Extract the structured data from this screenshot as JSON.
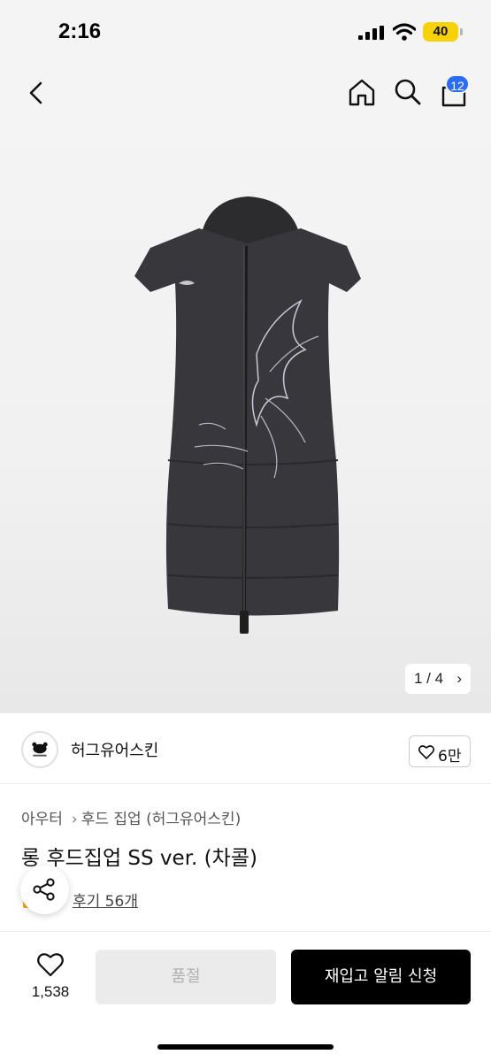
{
  "status_bar": {
    "time": "2:16",
    "battery": "40"
  },
  "nav": {
    "cart_badge": "12"
  },
  "gallery": {
    "counter": "1 / 4",
    "counter_chevron": "›"
  },
  "brand": {
    "name": "허그유어스킨",
    "like_count": "6만"
  },
  "breadcrumb": {
    "items": [
      "아우터",
      "후드 집업 (허그유어스킨)"
    ],
    "separator": "›"
  },
  "product": {
    "title": "롱 후드집업 SS ver. (차콜)",
    "review_link": "후기 56개"
  },
  "actions": {
    "wish_count": "1,538",
    "soldout_label": "품절",
    "restock_label": "재입고 알림 신청"
  },
  "colors": {
    "accent_badge": "#2a6df4",
    "battery": "#f5d20a",
    "primary_button": "#000000"
  }
}
